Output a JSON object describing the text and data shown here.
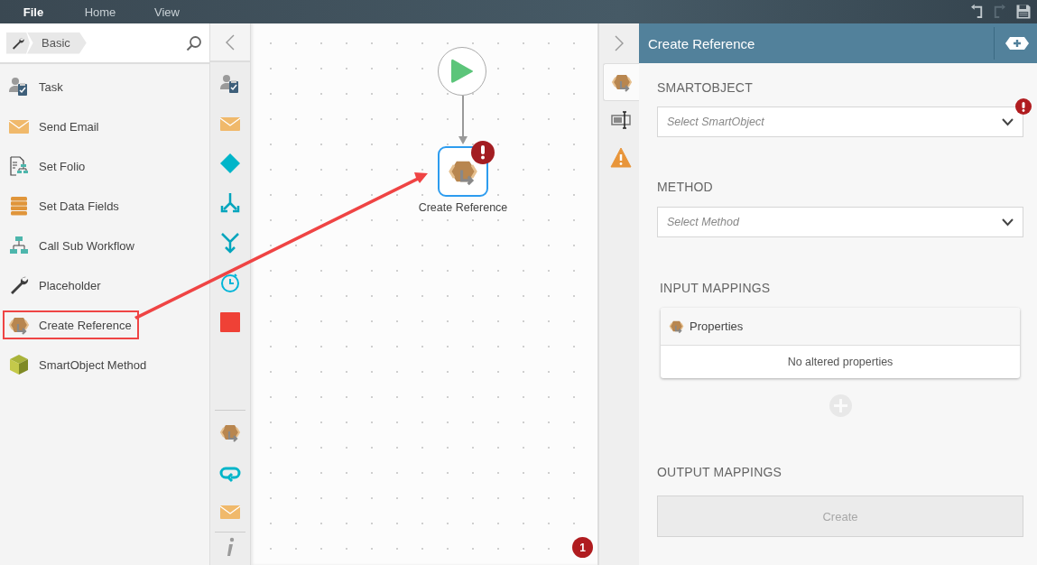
{
  "menu": [
    {
      "label": "File",
      "selected": true
    },
    {
      "label": "Home",
      "selected": false
    },
    {
      "label": "View",
      "selected": false
    }
  ],
  "actions": [
    {
      "kind": "undo",
      "disabled": false
    },
    {
      "kind": "redo",
      "disabled": true
    },
    {
      "kind": "save",
      "disabled": false
    }
  ],
  "toolbox": {
    "breadcrumb": "Basic",
    "items": [
      {
        "label": "Task",
        "kind": "task",
        "highlighted": false
      },
      {
        "label": "Send Email",
        "kind": "email",
        "highlighted": false
      },
      {
        "label": "Set Folio",
        "kind": "folio",
        "highlighted": false
      },
      {
        "label": "Set Data Fields",
        "kind": "datafields",
        "highlighted": false
      },
      {
        "label": "Call Sub Workflow",
        "kind": "subworkflow",
        "highlighted": false
      },
      {
        "label": "Placeholder",
        "kind": "placeholder",
        "highlighted": false
      },
      {
        "label": "Create Reference",
        "kind": "reference",
        "highlighted": true
      },
      {
        "label": "SmartObject Method",
        "kind": "smartobject",
        "highlighted": false
      }
    ]
  },
  "palette": {
    "items": [
      {
        "kind": "task"
      },
      {
        "kind": "email"
      },
      {
        "kind": "decision"
      },
      {
        "kind": "split"
      },
      {
        "kind": "merge"
      },
      {
        "kind": "timer"
      },
      {
        "kind": "end"
      }
    ],
    "recent": [
      {
        "kind": "reference"
      },
      {
        "kind": "loop"
      },
      {
        "kind": "email"
      }
    ]
  },
  "canvas": {
    "node": {
      "label": "Create Reference",
      "kind": "reference",
      "selected": true,
      "error": true
    },
    "error_count": "1"
  },
  "panel": {
    "title": "Create Reference",
    "tabs": [
      {
        "kind": "reference",
        "selected": true
      },
      {
        "kind": "properties",
        "selected": false
      },
      {
        "kind": "warning",
        "selected": false
      }
    ],
    "smartobject": {
      "heading": "SMARTOBJECT",
      "placeholder": "Select SmartObject",
      "error": true
    },
    "method": {
      "heading": "METHOD",
      "placeholder": "Select Method",
      "error": false
    },
    "input_mappings": {
      "heading": "INPUT MAPPINGS",
      "title": "Properties",
      "empty_text": "No altered properties"
    },
    "output_mappings": {
      "heading": "OUTPUT MAPPINGS",
      "button": {
        "label": "Create",
        "disabled": true
      }
    }
  }
}
